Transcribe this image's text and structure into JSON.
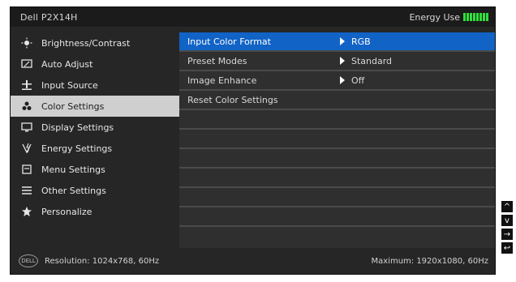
{
  "header": {
    "model": "Dell P2X14H",
    "energy_label": "Energy Use",
    "energy_segments": 8,
    "energy_color": "#2fe03a"
  },
  "sidebar": {
    "items": [
      {
        "label": "Brightness/Contrast",
        "icon": "brightness-icon"
      },
      {
        "label": "Auto Adjust",
        "icon": "auto-adjust-icon"
      },
      {
        "label": "Input Source",
        "icon": "input-source-icon"
      },
      {
        "label": "Color Settings",
        "icon": "color-settings-icon",
        "active": true
      },
      {
        "label": "Display Settings",
        "icon": "display-settings-icon"
      },
      {
        "label": "Energy Settings",
        "icon": "energy-settings-icon"
      },
      {
        "label": "Menu Settings",
        "icon": "menu-settings-icon"
      },
      {
        "label": "Other Settings",
        "icon": "other-settings-icon"
      },
      {
        "label": "Personalize",
        "icon": "star-icon"
      }
    ]
  },
  "panel": {
    "rows": [
      {
        "label": "Input Color Format",
        "value": "RGB",
        "highlight": true
      },
      {
        "label": "Preset Modes",
        "value": "Standard"
      },
      {
        "label": "Image Enhance",
        "value": "Off"
      },
      {
        "label": "Reset Color Settings",
        "value": ""
      },
      {
        "label": "",
        "value": ""
      },
      {
        "label": "",
        "value": ""
      },
      {
        "label": "",
        "value": ""
      },
      {
        "label": "",
        "value": ""
      },
      {
        "label": "",
        "value": ""
      },
      {
        "label": "",
        "value": ""
      }
    ]
  },
  "footer": {
    "resolution": "Resolution: 1024x768, 60Hz",
    "maximum": "Maximum: 1920x1080, 60Hz",
    "logo_text": "DELL"
  },
  "nav": {
    "up": "^",
    "down": "v",
    "enter": "→",
    "back": "↩"
  }
}
